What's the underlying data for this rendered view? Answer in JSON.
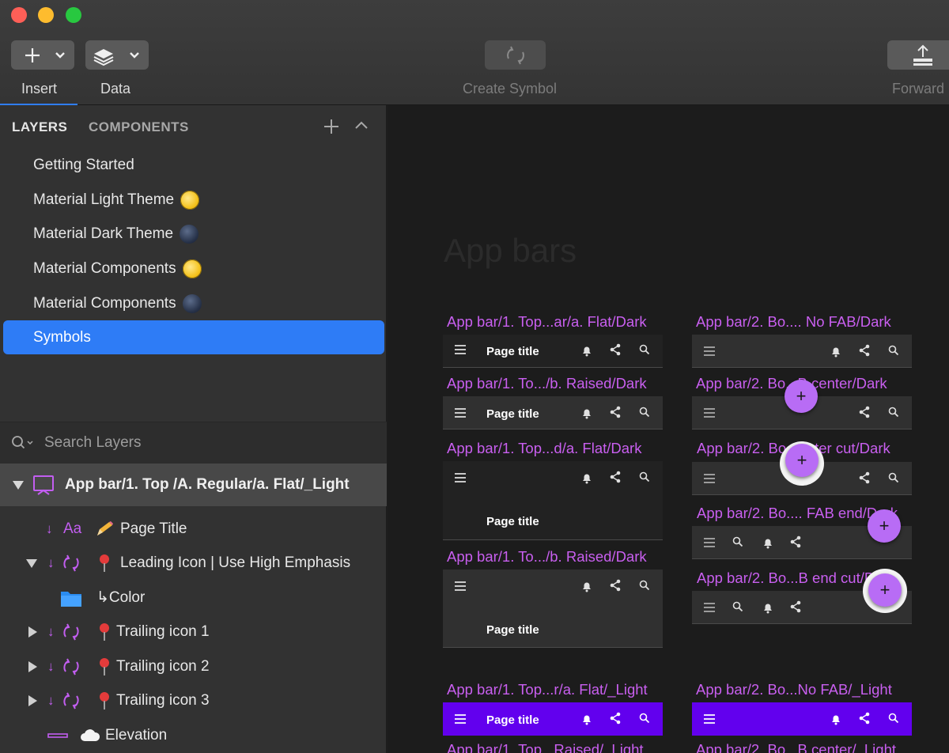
{
  "toolbar": {
    "insert_label": "Insert",
    "data_label": "Data",
    "create_symbol_label": "Create Symbol",
    "forward_label": "Forward"
  },
  "sidebar": {
    "tab_layers": "LAYERS",
    "tab_components": "COMPONENTS",
    "pages": [
      {
        "label": "Getting Started",
        "emoji": ""
      },
      {
        "label": "Material Light Theme",
        "emoji": "sun"
      },
      {
        "label": "Material Dark Theme",
        "emoji": "moon"
      },
      {
        "label": "Material Components",
        "emoji": "sun"
      },
      {
        "label": "Material Components",
        "emoji": "moon"
      },
      {
        "label": "Symbols",
        "emoji": "",
        "selected": true
      }
    ],
    "search_placeholder": "Search Layers",
    "symbol_title": "App bar/1. Top /A. Regular/a. Flat/_Light",
    "layers": [
      {
        "prefix": "Aa",
        "label": "Page Title",
        "icon": "pencil-icon"
      },
      {
        "label": "Leading Icon | Use High Emphasis",
        "icon": "pin-icon",
        "expanded": true
      },
      {
        "label": "↳Color",
        "icon": "folder-icon"
      },
      {
        "label": "Trailing icon 1",
        "icon": "pin-icon"
      },
      {
        "label": "Trailing icon 2",
        "icon": "pin-icon"
      },
      {
        "label": "Trailing icon 3",
        "icon": "pin-icon"
      },
      {
        "label": "Elevation",
        "icon": "cloud-icon"
      }
    ]
  },
  "canvas": {
    "title": "App bars",
    "labels": {
      "l1": "App bar/1. Top...ar/a. Flat/Dark",
      "l2": "App bar/1. To.../b. Raised/Dark",
      "l3": "App bar/1. Top...d/a. Flat/Dark",
      "l4": "App bar/1. To.../b. Raised/Dark",
      "l5": "App bar/1. Top...r/a. Flat/_Light",
      "l6": "App bar/1. Top...Raised/_Light",
      "r1": "App bar/2. Bo.... No FAB/Dark",
      "r2": "App bar/2. Bo...B center/Dark",
      "r3": "App bar/2. Bo...enter cut/Dark",
      "r4": "App bar/2. Bo.... FAB end/Dark",
      "r5": "App bar/2. Bo...B end cut/Dark",
      "r6": "App bar/2. Bo...No FAB/_Light",
      "r7": "App bar/2. Bo...B center/_Light"
    },
    "page_title": "Page title",
    "fab_symbol": "+",
    "colors": {
      "label": "#c95ff0",
      "fab": "#b86cf5",
      "light_bar": "#6200ee",
      "selection": "#2e7cf6"
    }
  }
}
